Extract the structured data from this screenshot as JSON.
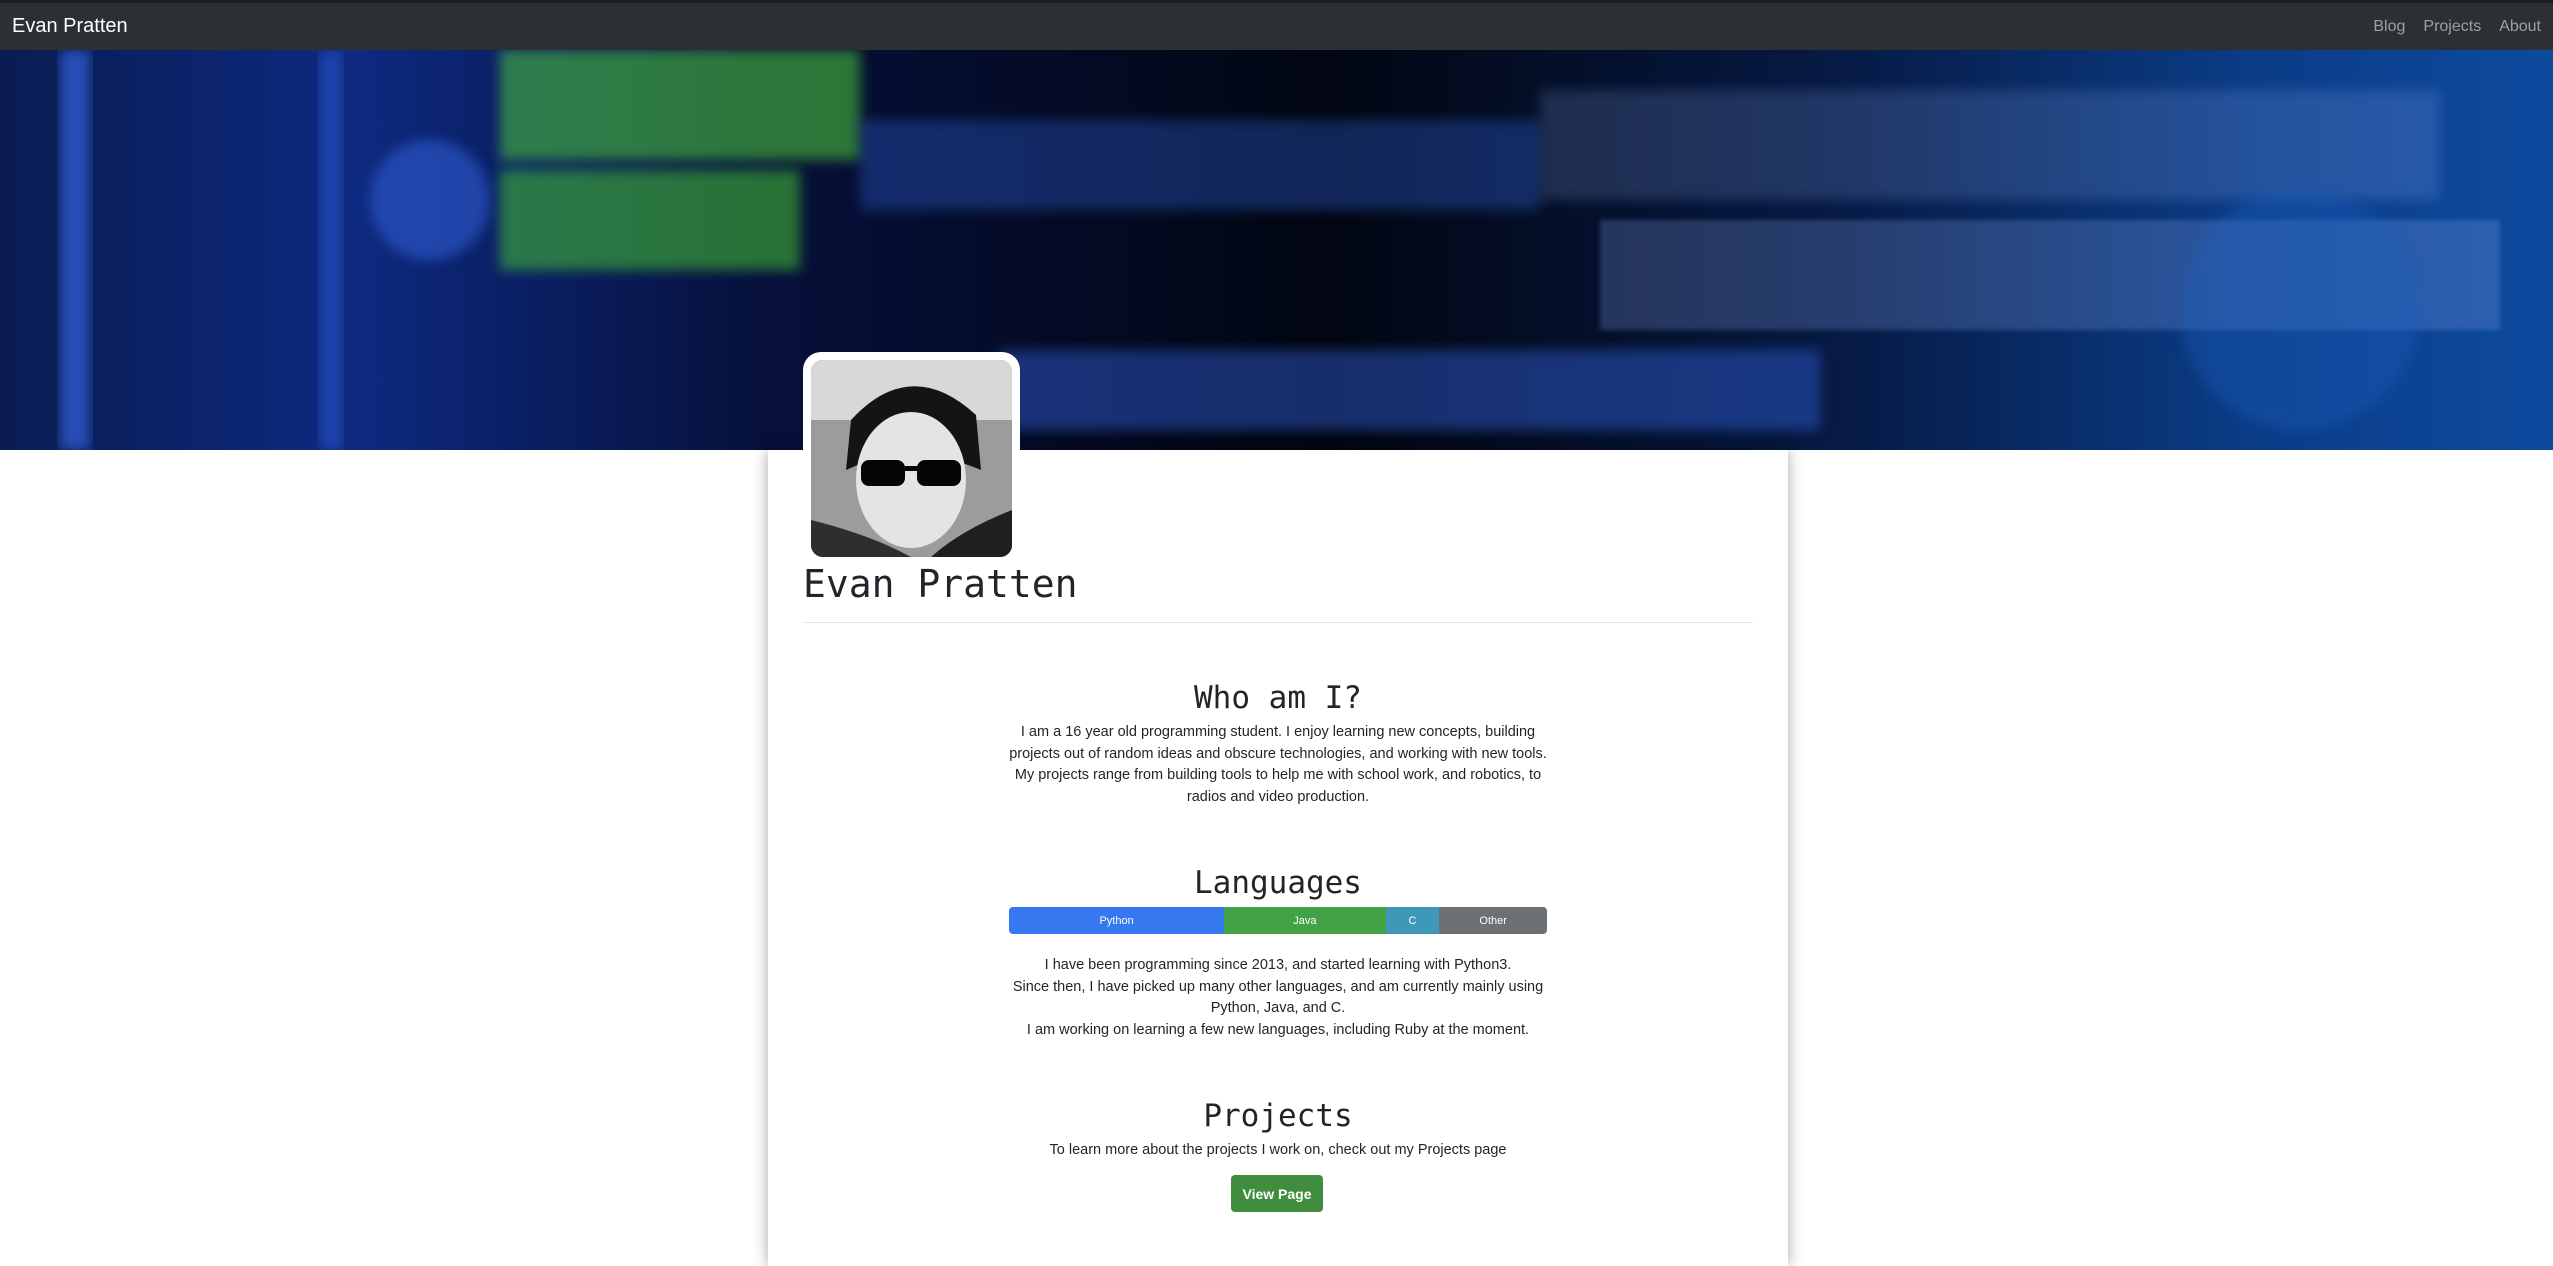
{
  "navbar": {
    "brand": "Evan Pratten",
    "links": [
      "Blog",
      "Projects",
      "About"
    ]
  },
  "profile": {
    "name": "Evan Pratten"
  },
  "about": {
    "title": "Who am I?",
    "lines": [
      "I am a 16 year old programming student. I enjoy learning new concepts, building",
      "projects out of random ideas and obscure technologies, and working with new tools.",
      "My projects range from building tools to help me with school work, and robotics, to",
      "radios and video production."
    ]
  },
  "languages": {
    "title": "Languages",
    "bar": [
      {
        "label": "Python",
        "percent": 40,
        "color": "#3578f0"
      },
      {
        "label": "Java",
        "percent": 30,
        "color": "#44a246"
      },
      {
        "label": "C",
        "percent": 10,
        "color": "#4098b8"
      },
      {
        "label": "Other",
        "percent": 20,
        "color": "#6d7176"
      }
    ],
    "lines": [
      "I have been programming since 2013, and started learning with Python3.",
      "Since then, I have picked up many other languages, and am currently mainly using",
      "Python, Java, and C.",
      "I am working on learning a few new languages, including Ruby at the moment."
    ]
  },
  "projects": {
    "title": "Projects",
    "text": "To learn more about the projects I work on, check out my Projects page",
    "button_label": "View Page"
  },
  "colors": {
    "navbar": "#2d3033",
    "button": "#3f8d3d"
  }
}
